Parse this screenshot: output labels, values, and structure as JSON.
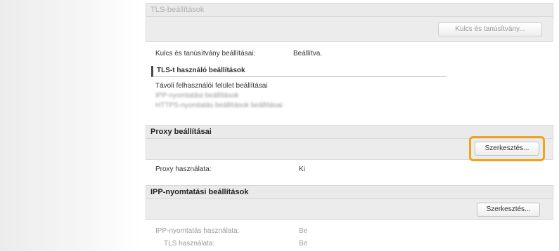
{
  "tls": {
    "header": "TLS-beállítások",
    "key_button": "Kulcs és tanúsítvány...",
    "key_row_label": "Kulcs és tanúsítvány beállításai:",
    "key_row_value": "Beállítva.",
    "subhead": "TLS-t használó beállítások",
    "remote_ui": "Távoli felhasználói felület beállításai",
    "blurred_line_1": "IPP-nyomtatási beállítások",
    "blurred_line_2": "HTTPS-nyomtatás beállítások beállításai"
  },
  "proxy": {
    "header": "Proxy beállításai",
    "edit_button": "Szerkesztés...",
    "row_label": "Proxy használata:",
    "row_value": "Ki"
  },
  "ipp": {
    "header": "IPP-nyomtatási beállítások",
    "edit_button": "Szerkesztés...",
    "row1_label": "IPP-nyomtatás használata:",
    "row1_value": "Be",
    "row2_label": "TLS használata:",
    "row2_value": "Be"
  },
  "colors": {
    "highlight": "#f2a31b"
  }
}
